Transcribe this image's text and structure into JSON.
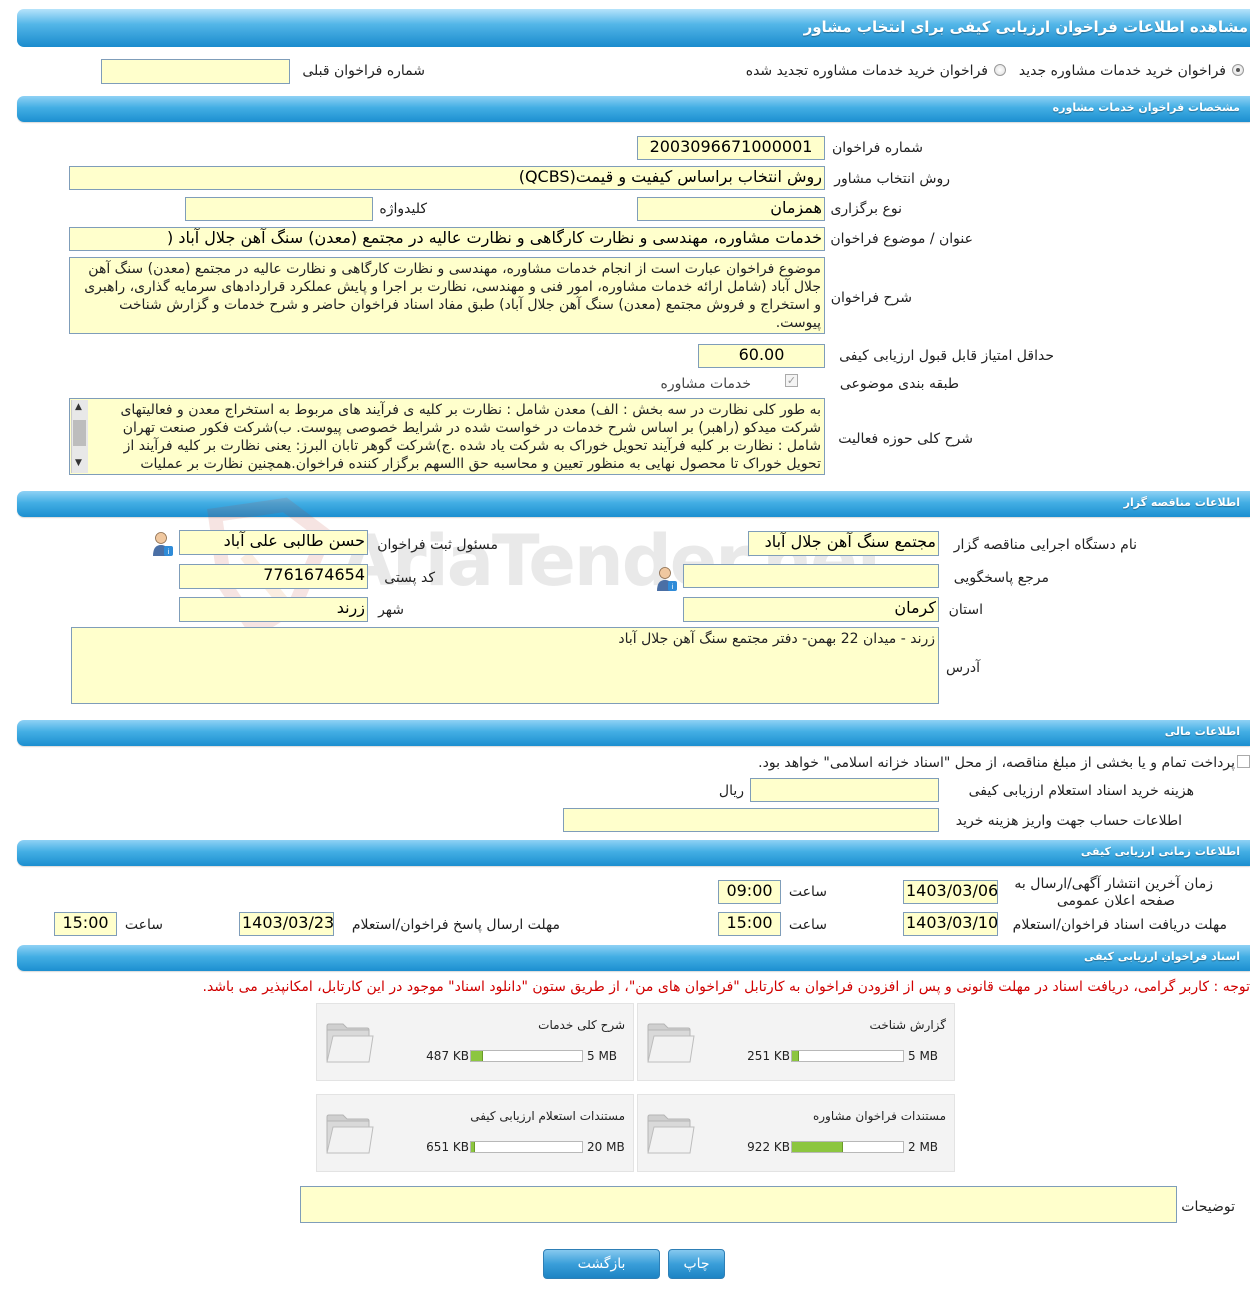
{
  "header": {
    "title": "مشاهده اطلاعات فراخوان ارزیابی کیفی برای انتخاب مشاور"
  },
  "mode": {
    "option_new": "فراخوان خرید خدمات مشاوره جدید",
    "option_renewed": "فراخوان خرید خدمات مشاوره تجدید شده",
    "prev_call_label": "شماره فراخوان قبلی",
    "prev_call_value": ""
  },
  "sections": {
    "spec": "مشخصات فراخوان خدمات مشاوره",
    "tenderer": "اطلاعات مناقصه گزار",
    "financial": "اطلاعات مالی",
    "timing": "اطلاعات زمانی ارزیابی کیفی",
    "docs": "اسناد فراخوان ارزیابی کیفی"
  },
  "spec": {
    "call_number_label": "شماره فراخوان",
    "call_number": "2003096671000001",
    "method_label": "روش انتخاب مشاور",
    "method": "روش انتخاب براساس کیفیت و قیمت(QCBS)",
    "type_label": "نوع برگزاری",
    "type": "همزمان",
    "keyword_label": "کلیدواژه",
    "keyword": "",
    "subject_label": "عنوان / موضوع فراخوان",
    "subject": "خدمات مشاوره، مهندسی و نظارت کارگاهی و نظارت عالیه در مجتمع (معدن) سنگ آهن جلال آباد (",
    "desc_label": "شرح فراخوان",
    "desc": "موضوع فراخوان عبارت است از انجام خدمات مشاوره، مهندسی و نظارت کارگاهی و نظارت عالیه در مجتمع (معدن) سنگ آهن جلال آباد (شامل ارائه خدمات مشاوره، امور فنی و مهندسی، نظارت بر اجرا و پایش عملکرد قراردادهای سرمایه گذاری، راهبری و استخراج و فروش مجتمع (معدن)  سنگ آهن جلال آباد)  طبق مفاد  اسناد فراخوان حاضر و شرح خدمات و گزارش شناخت پیوست.",
    "min_score_label": "حداقل امتیاز قابل قبول ارزیابی کیفی",
    "min_score": "60.00",
    "category_label": "طبقه بندی موضوعی",
    "category": "خدمات مشاوره",
    "scope_label": "شرح کلی حوزه فعالیت",
    "scope": "به طور کلی نظارت در سه بخش : الف) معدن شامل : نظارت بر کلیه ی فرآیند های مربوط به استخراج معدن و فعالیتهای شرکت میدکو (راهبر) بر اساس شرح خدمات در خواست شده در شرایط خصوصی پیوست. ب)شرکت فکور صنعت تهران شامل : نظارت بر کلیه فرآیند تحویل خوراک به شرکت یاد شده .ج)شرکت گوهر تابان البرز:  یعنی نظارت بر کلیه فرآیند از تحویل خوراک تا محصول نهایی به منظور تعیین و محاسبه حق االسهم برگزار کننده فراخوان.همچنین نظارت بر عملیات"
  },
  "tenderer": {
    "org_label": "نام دستگاه اجرایی مناقصه گزار",
    "org": "مجتمع سنگ آهن جلال آباد",
    "registrar_label": "مسئول ثبت فراخوان",
    "registrar": "حسن طالبی علی آباد",
    "ref_label": "مرجع پاسخگویی",
    "ref": "",
    "postal_label": "کد پستی",
    "postal": "7761674654",
    "province_label": "استان",
    "province": "کرمان",
    "city_label": "شهر",
    "city": "زرند",
    "address_label": "آدرس",
    "address": "زرند - میدان 22 بهمن- دفتر مجتمع سنگ آهن جلال آباد"
  },
  "financial": {
    "islamic_note": "پرداخت تمام و یا بخشی از مبلغ مناقصه، از محل \"اسناد خزانه اسلامی\" خواهد بود.",
    "fee_label": "هزینه خرید اسناد استعلام ارزیابی کیفی",
    "fee": "",
    "fee_unit": "ریال",
    "account_label": "اطلاعات حساب جهت واریز هزینه خرید",
    "account": ""
  },
  "timing": {
    "publish_label_1": "زمان آخرین انتشار آگهی/ارسال به",
    "publish_label_2": "صفحه اعلان عمومی",
    "publish_date": "1403/03/06",
    "time_label": "ساعت",
    "publish_time": "09:00",
    "receive_label": "مهلت دریافت اسناد فراخوان/استعلام",
    "receive_date": "1403/03/10",
    "receive_time": "15:00",
    "submit_label": "مهلت ارسال پاسخ فراخوان/استعلام",
    "submit_date": "1403/03/23",
    "submit_time": "15:00"
  },
  "docs": {
    "notice": "توجه : کاربر گرامی، دریافت اسناد در مهلت قانونی و پس از افزودن فراخوان به کارتابل \"فراخوان های من\"، از طریق ستون \"دانلود اسناد\" موجود در این کارتابل، امکانپذیر می باشد.",
    "files": [
      {
        "name": "گزارش شناخت",
        "size": "251 KB",
        "max": "5 MB",
        "ratio": 0.05
      },
      {
        "name": "شرح کلی خدمات",
        "size": "487 KB",
        "max": "5 MB",
        "ratio": 0.1
      },
      {
        "name": "مستندات فراخوان مشاوره",
        "size": "922 KB",
        "max": "2 MB",
        "ratio": 0.45
      },
      {
        "name": "مستندات استعلام ارزیابی کیفی",
        "size": "651 KB",
        "max": "20 MB",
        "ratio": 0.03
      }
    ],
    "notes_label": "توضیحات",
    "notes": ""
  },
  "buttons": {
    "print": "چاپ",
    "back": "بازگشت"
  },
  "watermark": "AriaTender.net"
}
